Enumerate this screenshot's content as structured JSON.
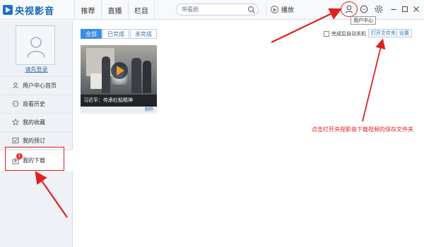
{
  "app": {
    "logo_text": "央视影音"
  },
  "nav": {
    "items": [
      "推荐",
      "直播",
      "栏目"
    ]
  },
  "search": {
    "placeholder": "带看剧"
  },
  "toolbar": {
    "play_label": "播放"
  },
  "tooltip": {
    "user_center": "用户中心"
  },
  "sidebar": {
    "login_link": "请先登录",
    "items": [
      {
        "label": "用户中心首页",
        "icon": "user-icon"
      },
      {
        "label": "观看历史",
        "icon": "history-icon"
      },
      {
        "label": "我的收藏",
        "icon": "star-icon"
      },
      {
        "label": "我的预订",
        "icon": "reserve-icon"
      },
      {
        "label": "我的下载",
        "icon": "download-icon",
        "badge": "1"
      }
    ]
  },
  "main": {
    "tabs": [
      {
        "label": "全部",
        "selected": true
      },
      {
        "label": "已完成",
        "selected": false
      },
      {
        "label": "未完成",
        "selected": false
      }
    ],
    "auto_shutdown_label": "完成后自动关机",
    "open_folder_label": "打开文件夹",
    "settings_label": "设置",
    "download_item": {
      "title": "习近平：传承红船精神",
      "delete_label": "删除"
    }
  },
  "annotation": {
    "hint": "点击打开央视影音下载视频的保存文件夹",
    "color": "#e02020"
  },
  "colors": {
    "accent": "#3a8ee6",
    "brand": "#1665b8"
  }
}
